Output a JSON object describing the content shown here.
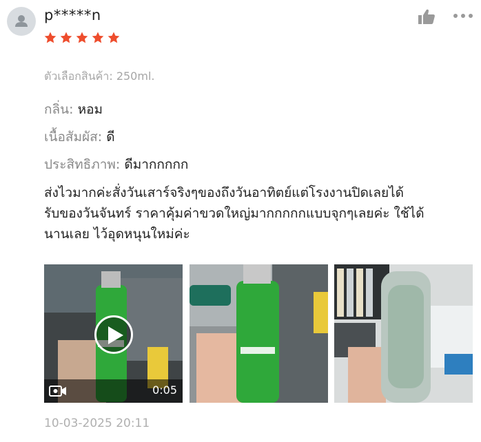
{
  "review": {
    "username": "p*****n",
    "rating": 5,
    "variation": "ตัวเลือกสินค้า: 250ml.",
    "attributes": [
      {
        "key": "กลิ่น:",
        "value": "หอม"
      },
      {
        "key": "เนื้อสัมผัส:",
        "value": "ดี"
      },
      {
        "key": "ประสิทธิภาพ:",
        "value": "ดีมากกกกก"
      }
    ],
    "text": "ส่งไวมากค่ะสั่งวันเสาร์จริงๆของถึงวันอาทิตย์แต่โรงงานปิดเลยได้\nรับของวันจันทร์ ราคาคุ้มค่าขวดใหญ่มากกกกกแบบจุกๆเลยค่ะ ใช้ได้\nนานเลย ไว้อุดหนุนใหม่ค่ะ",
    "video_duration": "0:05",
    "date": "10-03-2025 20:11"
  },
  "icons": {
    "like": "thumbs-up-icon",
    "more": "more-dots-icon",
    "star": "star-icon",
    "play": "play-icon",
    "video": "video-camera-icon"
  },
  "colors": {
    "star": "#ee4d2d",
    "muted_text": "#a6a6a6",
    "label_text": "#8a8a8a",
    "bottle_green": "#2fa83a"
  }
}
